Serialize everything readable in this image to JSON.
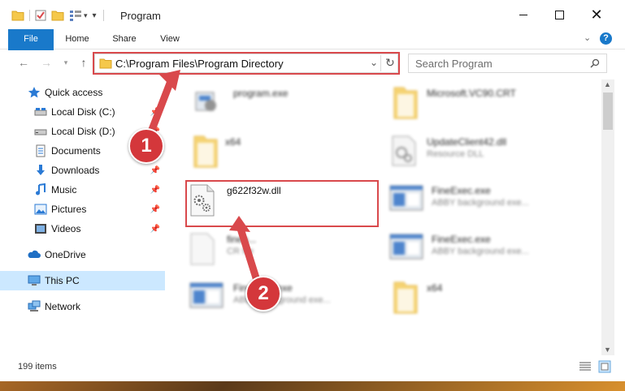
{
  "window": {
    "title": "Program",
    "controls": [
      "minimize-icon",
      "maximize-icon",
      "close-icon"
    ]
  },
  "ribbon": {
    "tabs": [
      {
        "label": "File"
      },
      {
        "label": "Home"
      },
      {
        "label": "Share"
      },
      {
        "label": "View"
      }
    ],
    "help_symbol": "?"
  },
  "navigation": {
    "address_path": "C:\\Program Files\\Program Directory",
    "search_placeholder": "Search Program"
  },
  "sidebar": {
    "items": [
      {
        "label": "Quick access",
        "icon": "star-icon",
        "pinned": false
      },
      {
        "label": "Local Disk (C:)",
        "icon": "drive-icon",
        "pinned": true
      },
      {
        "label": "Local Disk (D:)",
        "icon": "drive-icon",
        "pinned": true
      },
      {
        "label": "Documents",
        "icon": "documents-icon",
        "pinned": true
      },
      {
        "label": "Downloads",
        "icon": "downloads-icon",
        "pinned": true
      },
      {
        "label": "Music",
        "icon": "music-icon",
        "pinned": true
      },
      {
        "label": "Pictures",
        "icon": "pictures-icon",
        "pinned": true
      },
      {
        "label": "Videos",
        "icon": "videos-icon",
        "pinned": true
      },
      {
        "label": "OneDrive",
        "icon": "onedrive-icon",
        "pinned": false
      },
      {
        "label": "This PC",
        "icon": "pc-icon",
        "pinned": false,
        "selected": true
      },
      {
        "label": "Network",
        "icon": "network-icon",
        "pinned": false
      }
    ]
  },
  "files": [
    {
      "name": "program.exe",
      "sub": "",
      "icon": "app-icon",
      "blurred": true
    },
    {
      "name": "Microsoft.VC90.CRT",
      "sub": "",
      "icon": "folder-icon",
      "blurred": true
    },
    {
      "name": "x64",
      "sub": "",
      "icon": "folder-icon",
      "blurred": true
    },
    {
      "name": "UpdateClient42.dll",
      "sub": "Resource DLL",
      "icon": "dll-icon",
      "blurred": true
    },
    {
      "name": "g622f32w.dll",
      "sub": "",
      "icon": "dll-icon",
      "blurred": false
    },
    {
      "name": "FineExec.exe",
      "sub": "ABBY background exe...",
      "icon": "exe-window-icon",
      "blurred": true
    },
    {
      "name": "fineo...",
      "sub": "CR file",
      "icon": "file-icon",
      "blurred": true
    },
    {
      "name": "FineExec.exe",
      "sub": "ABBY background exe...",
      "icon": "exe-window-icon",
      "blurred": true
    },
    {
      "name": "FineExec.exe",
      "sub": "ABBY background exe...",
      "icon": "exe-window-icon",
      "blurred": true
    },
    {
      "name": "x64",
      "sub": "",
      "icon": "folder-icon",
      "blurred": true
    }
  ],
  "status": {
    "item_count": "199 items"
  },
  "annotations": {
    "step1": "1",
    "step2": "2",
    "color": "#d9494c"
  },
  "colors": {
    "accent": "#1979ca",
    "selection": "#cce8ff",
    "highlight": "#d9494c"
  }
}
